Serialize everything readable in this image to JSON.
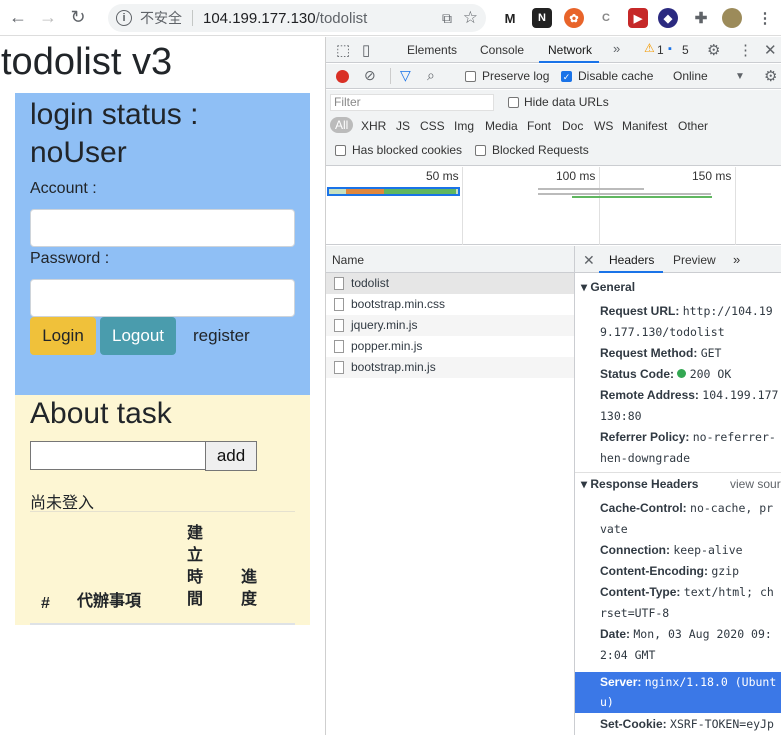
{
  "browser": {
    "insecure_label": "不安全",
    "url_host": "104.199.177.130",
    "url_path": "/todolist"
  },
  "page": {
    "title": "todolist v3",
    "login": {
      "status": "login status : noUser",
      "account_label": "Account :",
      "password_label": "Password :",
      "login_btn": "Login",
      "logout_btn": "Logout",
      "register_link": "register"
    },
    "task": {
      "title": "About task",
      "add_btn": "add",
      "not_logged_in": "尚未登入",
      "columns": [
        "#",
        "代辦事項",
        "建立時間",
        "進度"
      ]
    }
  },
  "devtools": {
    "tabs": [
      "Elements",
      "Console",
      "Network"
    ],
    "warn_count": "1",
    "msg_count": "5",
    "toolbar": {
      "preserve_log": "Preserve log",
      "disable_cache": "Disable cache",
      "throttle": "Online"
    },
    "filter": {
      "placeholder": "Filter",
      "hide_data_urls": "Hide data URLs",
      "types": [
        "All",
        "XHR",
        "JS",
        "CSS",
        "Img",
        "Media",
        "Font",
        "Doc",
        "WS",
        "Manifest",
        "Other"
      ],
      "blocked_cookies": "Has blocked cookies",
      "blocked_requests": "Blocked Requests"
    },
    "timeline_ticks": [
      "50 ms",
      "100 ms",
      "150 ms"
    ],
    "requests": {
      "header": "Name",
      "items": [
        "todolist",
        "bootstrap.min.css",
        "jquery.min.js",
        "popper.min.js",
        "bootstrap.min.js"
      ]
    },
    "details": {
      "tabs": [
        "Headers",
        "Preview"
      ],
      "general_title": "General",
      "general": [
        {
          "key": "Request URL:",
          "value": "http://104.19"
        },
        {
          "key": "",
          "value": "9.177.130/todolist"
        },
        {
          "key": "Request Method:",
          "value": "GET"
        },
        {
          "key": "Status Code:",
          "value": "200 OK"
        },
        {
          "key": "Remote Address:",
          "value": "104.199.177"
        },
        {
          "key": "",
          "value": "130:80"
        },
        {
          "key": "Referrer Policy:",
          "value": "no-referrer-"
        },
        {
          "key": "",
          "value": "hen-downgrade"
        }
      ],
      "response_title": "Response Headers",
      "view_source": "view sour",
      "response": [
        {
          "key": "Cache-Control:",
          "value": "no-cache, pr"
        },
        {
          "key": "",
          "value": "vate"
        },
        {
          "key": "Connection:",
          "value": "keep-alive"
        },
        {
          "key": "Content-Encoding:",
          "value": "gzip"
        },
        {
          "key": "Content-Type:",
          "value": "text/html; ch"
        },
        {
          "key": "",
          "value": "rset=UTF-8"
        },
        {
          "key": "Date:",
          "value": "Mon, 03 Aug 2020 09:"
        },
        {
          "key": "",
          "value": "2:04 GMT"
        }
      ],
      "server_key": "Server:",
      "server_value": "nginx/1.18.0 (Ubunt",
      "server_value2": "u)",
      "cookie_key": "Set-Cookie:",
      "cookie_value": "XSRF-TOKEN=eyJp"
    }
  }
}
